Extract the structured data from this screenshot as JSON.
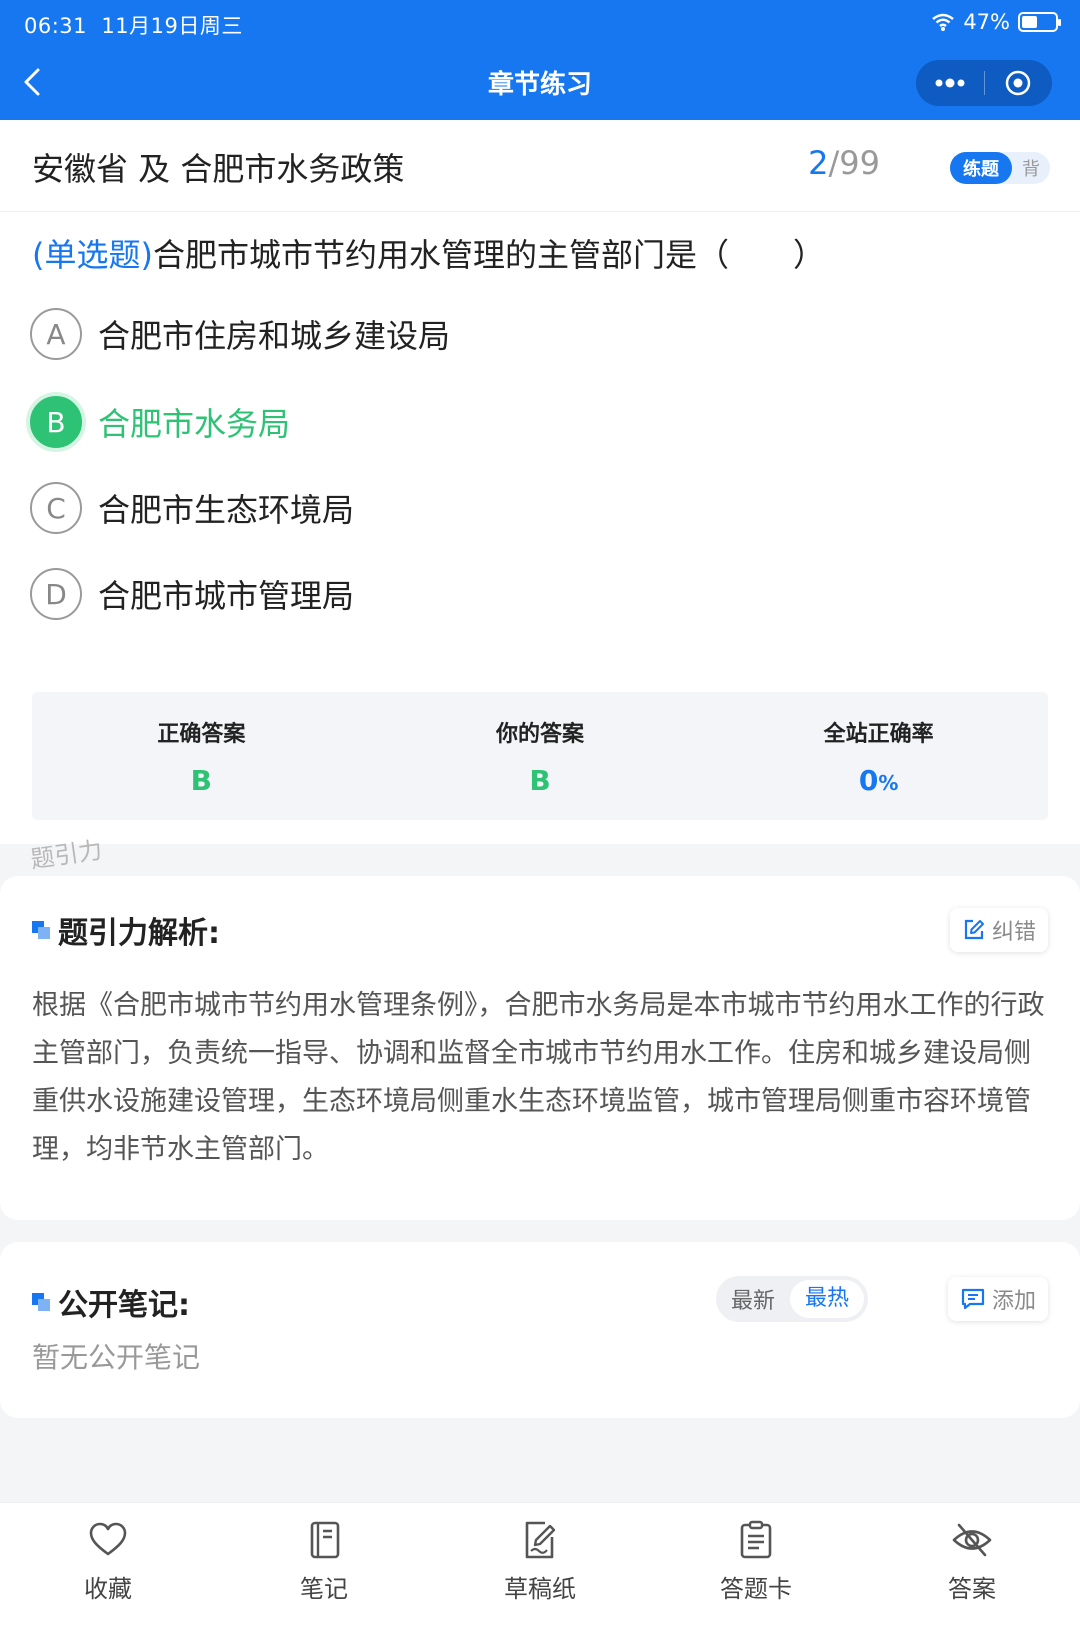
{
  "status_bar": {
    "time": "06:31",
    "date": "11月19日周三",
    "battery": "47%",
    "battery_level": 0.47
  },
  "nav": {
    "title": "章节练习",
    "back_icon": "chevron-left-icon",
    "more_icon": "more-dots-icon",
    "close_icon": "target-circle-icon"
  },
  "header": {
    "section_title": "安徽省 及 合肥市水务政策",
    "progress_current": "2",
    "progress_total": "/99",
    "mode_active": "练题",
    "mode_inactive": "背"
  },
  "question": {
    "type": "(单选题)",
    "stem": "合肥市城市节约用水管理的主管部门是（　　）",
    "options": [
      {
        "letter": "A",
        "text": "合肥市住房和城乡建设局"
      },
      {
        "letter": "B",
        "text": "合肥市水务局"
      },
      {
        "letter": "C",
        "text": "合肥市生态环境局"
      },
      {
        "letter": "D",
        "text": "合肥市城市管理局"
      }
    ]
  },
  "answer_summary": {
    "correct_label": "正确答案",
    "correct_value": "B",
    "yours_label": "你的答案",
    "yours_value": "B",
    "rate_label": "全站正确率",
    "rate_value": "0",
    "rate_unit": "%"
  },
  "watermark": "题引力",
  "analysis": {
    "title": "题引力解析:",
    "report_label": "纠错",
    "text": "根据《合肥市城市节约用水管理条例》，合肥市水务局是本市城市节约用水工作的行政主管部门，负责统一指导、协调和监督全市城市节约用水工作。住房和城乡建设局侧重供水设施建设管理，生态环境局侧重水生态环境监管，城市管理局侧重市容环境管理，均非节水主管部门。"
  },
  "notes": {
    "title": "公开笔记:",
    "sort_newest": "最新",
    "sort_hottest": "最热",
    "add_label": "添加",
    "empty_text": "暂无公开笔记"
  },
  "tabbar": [
    {
      "label": "收藏",
      "icon": "heart-icon"
    },
    {
      "label": "笔记",
      "icon": "notebook-icon"
    },
    {
      "label": "草稿纸",
      "icon": "draft-paper-icon"
    },
    {
      "label": "答题卡",
      "icon": "answer-card-icon"
    },
    {
      "label": "答案",
      "icon": "eye-off-icon"
    }
  ],
  "colors": {
    "primary": "#1677f0",
    "correct": "#2ec275"
  }
}
